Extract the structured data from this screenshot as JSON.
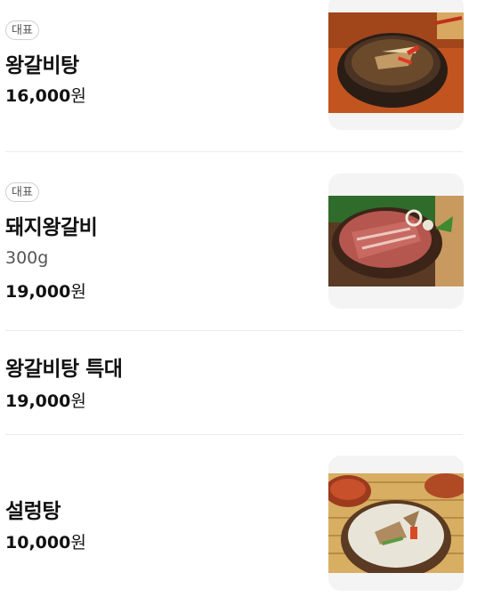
{
  "menu": {
    "items": [
      {
        "badge": "대표",
        "name": "왕갈비탕",
        "price_num": "16,000",
        "price_unit": "원",
        "image_icon": "galbitang-photo"
      },
      {
        "badge": "대표",
        "name": "돼지왕갈비",
        "desc": "300g",
        "price_num": "19,000",
        "price_unit": "원",
        "image_icon": "pork-galbi-photo"
      },
      {
        "name": "왕갈비탕 특대",
        "price_num": "19,000",
        "price_unit": "원"
      },
      {
        "name": "설렁탕",
        "price_num": "10,000",
        "price_unit": "원",
        "image_icon": "seolleongtang-photo"
      }
    ]
  }
}
